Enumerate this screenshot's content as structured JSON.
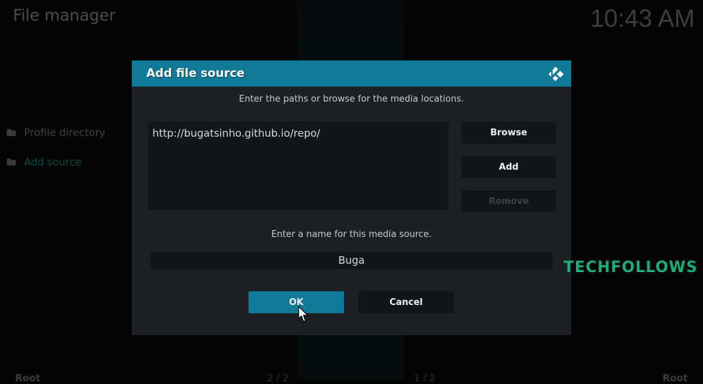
{
  "app": {
    "title": "File manager",
    "clock": "10:43 AM"
  },
  "sidebar": {
    "items": [
      {
        "label": "Profile directory",
        "icon": "folder-icon",
        "active": false
      },
      {
        "label": "Add source",
        "icon": "folder-icon",
        "active": true
      }
    ]
  },
  "footer": {
    "left_label": "Root",
    "left_count": "2 / 2",
    "right_count": "1 / 2",
    "right_label": "Root"
  },
  "dialog": {
    "title": "Add file source",
    "logo": "kodi-logo-icon",
    "paths_hint": "Enter the paths or browse for the media locations.",
    "paths": [
      "http://bugatsinho.github.io/repo/"
    ],
    "browse_label": "Browse",
    "add_label": "Add",
    "remove_label": "Remove",
    "name_hint": "Enter a name for this media source.",
    "name_value": "Buga",
    "ok_label": "OK",
    "cancel_label": "Cancel",
    "accent_color": "#117a98"
  },
  "watermark": {
    "text": "TECHFOLLOWS"
  }
}
